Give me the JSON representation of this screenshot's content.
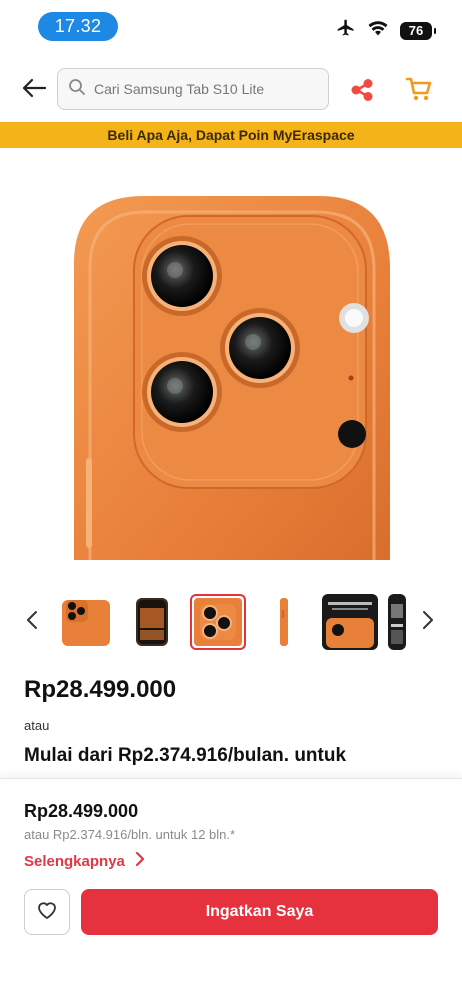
{
  "status_bar": {
    "time": "17.32",
    "battery": "76",
    "icons": [
      "airplane-icon",
      "wifi-icon",
      "battery-icon"
    ]
  },
  "header": {
    "search_placeholder": "Cari Samsung Tab S10 Lite",
    "icons": [
      "back-arrow-icon",
      "search-icon",
      "share-icon",
      "cart-icon"
    ]
  },
  "promo_banner": {
    "text": "Beli Apa Aja, Dapat Poin MyEraspace",
    "color": "#f5b31a"
  },
  "gallery": {
    "thumbnail_count": 6,
    "active_index": 2,
    "icons": [
      "chevron-left-icon",
      "chevron-right-icon"
    ]
  },
  "product": {
    "price": "Rp28.499.000",
    "or_label": "atau",
    "installment": "Mulai dari Rp2.374.916/bulan. untuk"
  },
  "bottom_sheet": {
    "price": "Rp28.499.000",
    "installment_sub": "atau Rp2.374.916/bln. untuk 12 bln.*",
    "more_label": "Selengkapnya",
    "remind_button": "Ingatkan Saya",
    "icons": [
      "chevron-right-icon",
      "heart-icon"
    ]
  },
  "colors": {
    "accent": "#e6313f",
    "status_pill": "#1e88e5",
    "product": "#e8803a"
  }
}
